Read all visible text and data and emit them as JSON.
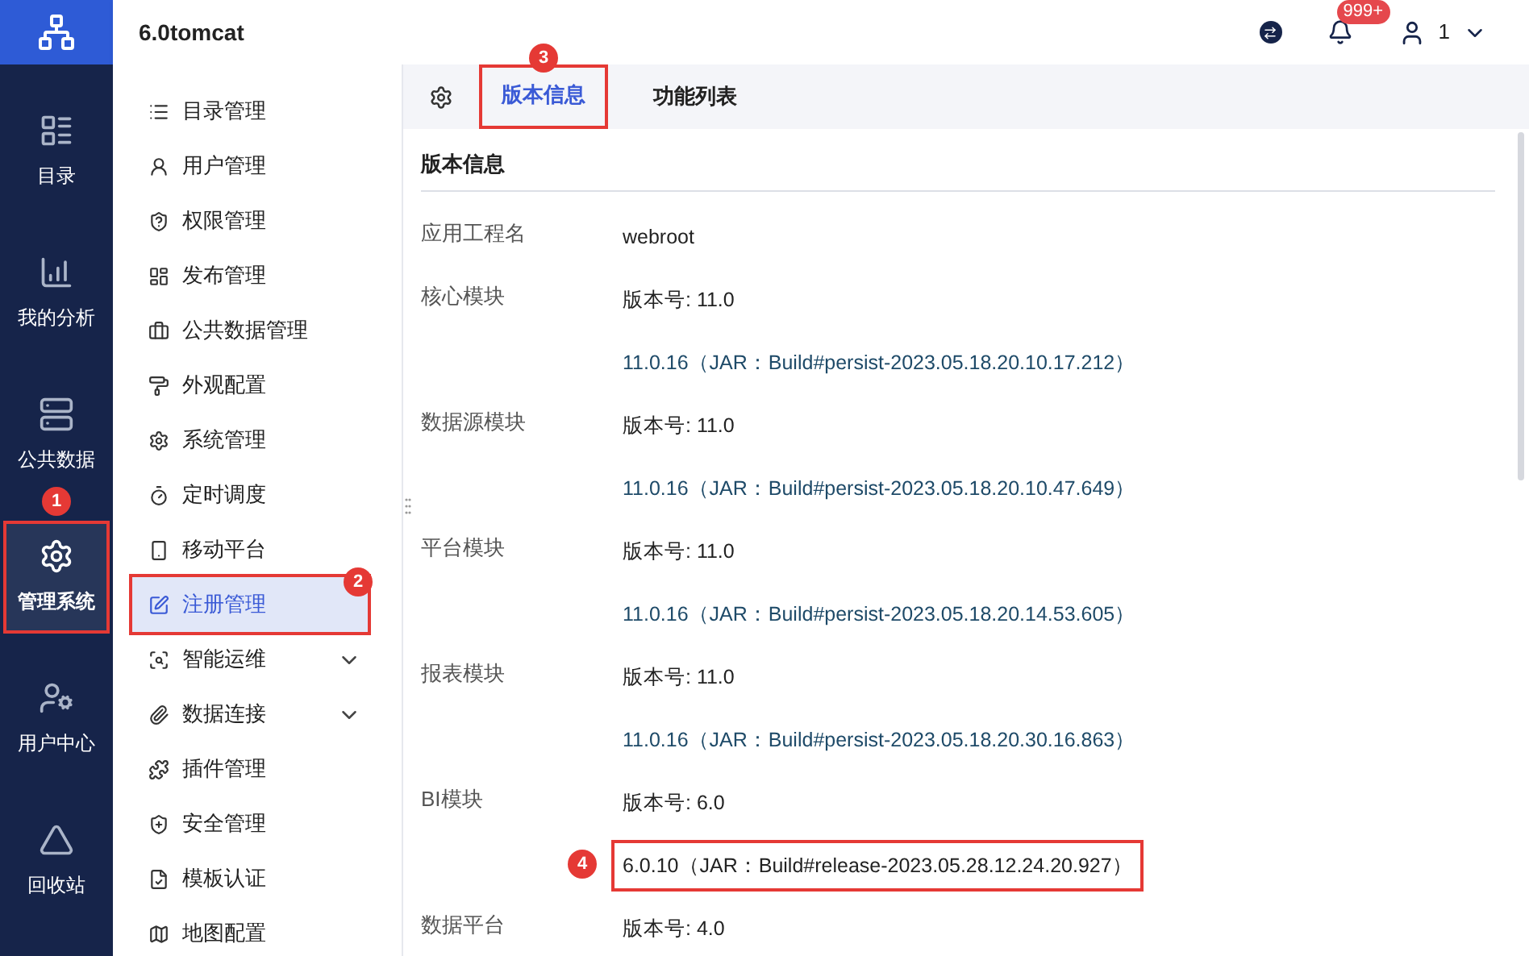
{
  "app": {
    "title": "6.0tomcat"
  },
  "topbar": {
    "notification_badge": "999+",
    "user": "1"
  },
  "nav": [
    {
      "label": "目录",
      "selected": false
    },
    {
      "label": "我的分析",
      "selected": false
    },
    {
      "label": "公共数据",
      "selected": false
    },
    {
      "label": "管理系统",
      "selected": true,
      "callout": "1"
    },
    {
      "label": "用户中心",
      "selected": false
    },
    {
      "label": "回收站",
      "selected": false
    }
  ],
  "menu": [
    {
      "label": "目录管理",
      "selected": false,
      "expandable": false
    },
    {
      "label": "用户管理",
      "selected": false,
      "expandable": false
    },
    {
      "label": "权限管理",
      "selected": false,
      "expandable": false
    },
    {
      "label": "发布管理",
      "selected": false,
      "expandable": false
    },
    {
      "label": "公共数据管理",
      "selected": false,
      "expandable": false
    },
    {
      "label": "外观配置",
      "selected": false,
      "expandable": false
    },
    {
      "label": "系统管理",
      "selected": false,
      "expandable": false
    },
    {
      "label": "定时调度",
      "selected": false,
      "expandable": false
    },
    {
      "label": "移动平台",
      "selected": false,
      "expandable": false
    },
    {
      "label": "注册管理",
      "selected": true,
      "expandable": false,
      "callout": "2"
    },
    {
      "label": "智能运维",
      "selected": false,
      "expandable": true
    },
    {
      "label": "数据连接",
      "selected": false,
      "expandable": true
    },
    {
      "label": "插件管理",
      "selected": false,
      "expandable": false
    },
    {
      "label": "安全管理",
      "selected": false,
      "expandable": false
    },
    {
      "label": "模板认证",
      "selected": false,
      "expandable": false
    },
    {
      "label": "地图配置",
      "selected": false,
      "expandable": false
    }
  ],
  "tabs": [
    {
      "label": "版本信息",
      "selected": true,
      "callout": "3"
    },
    {
      "label": "功能列表",
      "selected": false
    }
  ],
  "section_title": "版本信息",
  "rows": [
    {
      "label": "应用工程名",
      "lines": [
        {
          "kind": "value",
          "text": "webroot"
        }
      ]
    },
    {
      "label": "核心模块",
      "lines": [
        {
          "kind": "value",
          "text": "版本号: 11.0"
        },
        {
          "kind": "build",
          "text": "11.0.16（JAR：Build#persist-2023.05.18.20.10.17.212）"
        }
      ]
    },
    {
      "label": "数据源模块",
      "lines": [
        {
          "kind": "value",
          "text": "版本号: 11.0"
        },
        {
          "kind": "build",
          "text": "11.0.16（JAR：Build#persist-2023.05.18.20.10.47.649）"
        }
      ]
    },
    {
      "label": "平台模块",
      "lines": [
        {
          "kind": "value",
          "text": "版本号: 11.0"
        },
        {
          "kind": "build",
          "text": "11.0.16（JAR：Build#persist-2023.05.18.20.14.53.605）"
        }
      ]
    },
    {
      "label": "报表模块",
      "lines": [
        {
          "kind": "value",
          "text": "版本号: 11.0"
        },
        {
          "kind": "build",
          "text": "11.0.16（JAR：Build#persist-2023.05.18.20.30.16.863）"
        }
      ]
    },
    {
      "label": "BI模块",
      "lines": [
        {
          "kind": "value",
          "text": "版本号: 6.0"
        },
        {
          "kind": "build",
          "text": "6.0.10（JAR：Build#release-2023.05.28.12.24.20.927）",
          "callout": "4"
        }
      ]
    },
    {
      "label": "数据平台",
      "lines": [
        {
          "kind": "value",
          "text": "版本号: 4.0"
        }
      ]
    }
  ]
}
